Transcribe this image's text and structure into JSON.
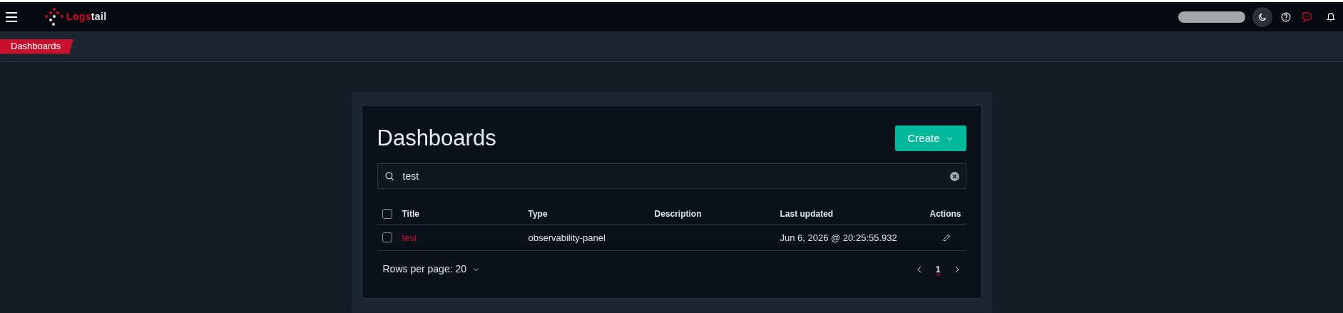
{
  "header": {
    "logo_text": "Logstail"
  },
  "breadcrumbs": [
    {
      "label": "Dashboards"
    }
  ],
  "page": {
    "title": "Dashboards",
    "create_button": "Create",
    "search": {
      "value": "test"
    },
    "table": {
      "select_all": {
        "checked": false
      },
      "columns": [
        "Title",
        "Type",
        "Description",
        "Last updated",
        "Actions"
      ],
      "rows": [
        {
          "checked": false,
          "title": "test",
          "type": "observability-panel",
          "description": "",
          "last_updated": "Jun 6, 2026 @ 20:25:55.932"
        }
      ]
    },
    "rows_per_page": "Rows per page: 20",
    "pages": [
      {
        "label": "1",
        "selected": true
      }
    ]
  }
}
